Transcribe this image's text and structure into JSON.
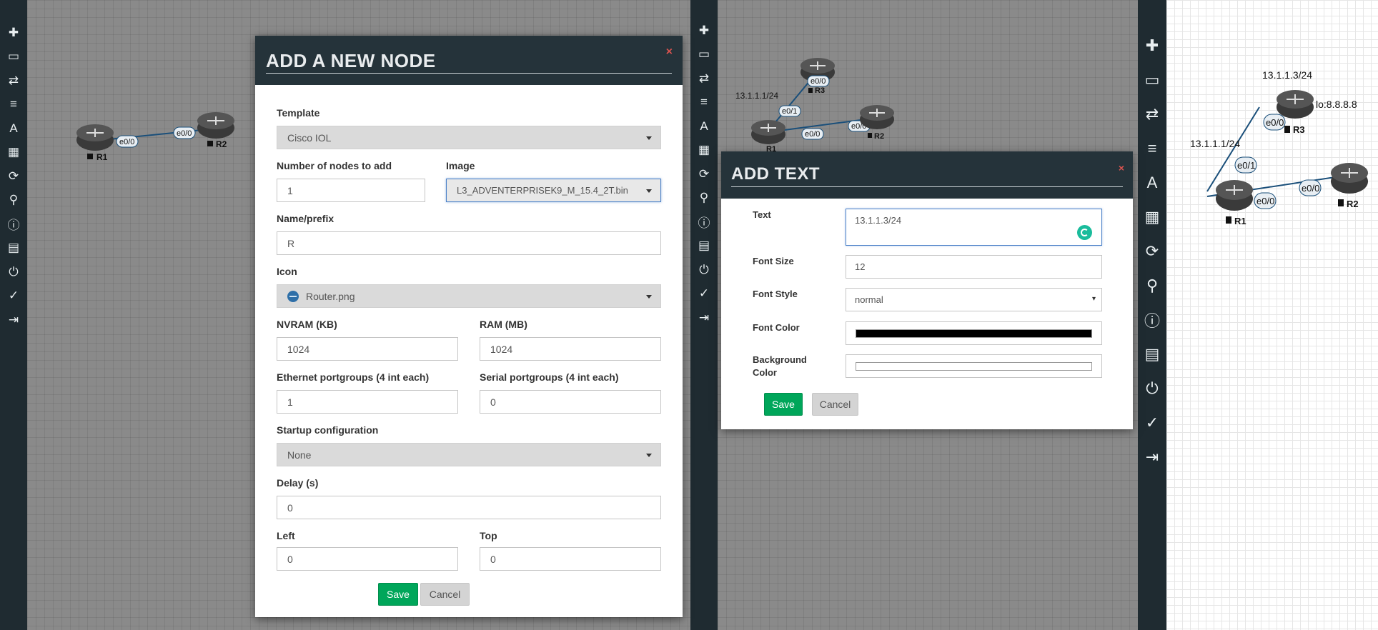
{
  "sidebar_icons": [
    "plus-icon",
    "server-icon",
    "exchange-icon",
    "align-left-icon",
    "font-icon",
    "grid-icon",
    "refresh-icon",
    "zoom-icon",
    "info-icon",
    "list-icon",
    "power-icon",
    "check-circle-icon",
    "logout-icon"
  ],
  "sidebar_glyphs": [
    "✚",
    "▭",
    "⇄",
    "≡",
    "A",
    "▦",
    "⟳",
    "⚲",
    "ⓘ",
    "▤",
    "⏻",
    "✓",
    "⇥"
  ],
  "panel1": {
    "nodes": {
      "r1": "R1",
      "r2": "R2"
    },
    "ports": {
      "r1_e00": "e0/0",
      "r2_e00": "e0/0"
    }
  },
  "node_modal": {
    "title": "ADD A NEW NODE",
    "close": "×",
    "template_label": "Template",
    "template_value": "Cisco IOL",
    "count_label": "Number of nodes to add",
    "count_value": "1",
    "image_label": "Image",
    "image_value": "L3_ADVENTERPRISEK9_M_15.4_2T.bin",
    "name_label": "Name/prefix",
    "name_value": "R",
    "icon_label": "Icon",
    "icon_value": "Router.png",
    "nvram_label": "NVRAM (KB)",
    "nvram_value": "1024",
    "ram_label": "RAM (MB)",
    "ram_value": "1024",
    "eth_label": "Ethernet portgroups (4 int each)",
    "eth_value": "1",
    "serial_label": "Serial portgroups (4 int each)",
    "serial_value": "0",
    "startup_label": "Startup configuration",
    "startup_value": "None",
    "delay_label": "Delay (s)",
    "delay_value": "0",
    "left_label": "Left",
    "left_value": "0",
    "top_label": "Top",
    "top_value": "0",
    "save": "Save",
    "cancel": "Cancel"
  },
  "panel2": {
    "nodes": {
      "r1": "R1",
      "r2": "R2",
      "r3": "R3"
    },
    "ports": {
      "r3_e00": "e0/0",
      "r1_e01": "e0/1",
      "r1_e00": "e0/0",
      "r2_e00": "e0/0"
    },
    "free_text": "13.1.1.1/24"
  },
  "text_modal": {
    "title": "ADD TEXT",
    "close": "×",
    "text_label": "Text",
    "text_value": "13.1.1.3/24",
    "font_size_label": "Font Size",
    "font_size_value": "12",
    "font_style_label": "Font Style",
    "font_style_value": "normal",
    "font_color_label": "Font Color",
    "font_color_value": "#000000",
    "bg_color_label_1": "Background",
    "bg_color_label_2": "Color",
    "bg_color_value": "#ffffff",
    "save": "Save",
    "cancel": "Cancel"
  },
  "panel3": {
    "nodes": {
      "r1": "R1",
      "r2": "R2",
      "r3": "R3"
    },
    "ports": {
      "r3_e00": "e0/0",
      "r1_e01": "e0/1",
      "r1_e00": "e0/0",
      "r2_e00": "e0/0"
    },
    "free_text_1": "13.1.1.3/24",
    "free_text_2": "lo:8.8.8.8",
    "free_text_3": "13.1.1.1/24"
  },
  "colors": {
    "sidebar": "#1f2b31",
    "modal_header": "#25333a",
    "save": "#00a65a",
    "link": "#1a4f7a"
  }
}
